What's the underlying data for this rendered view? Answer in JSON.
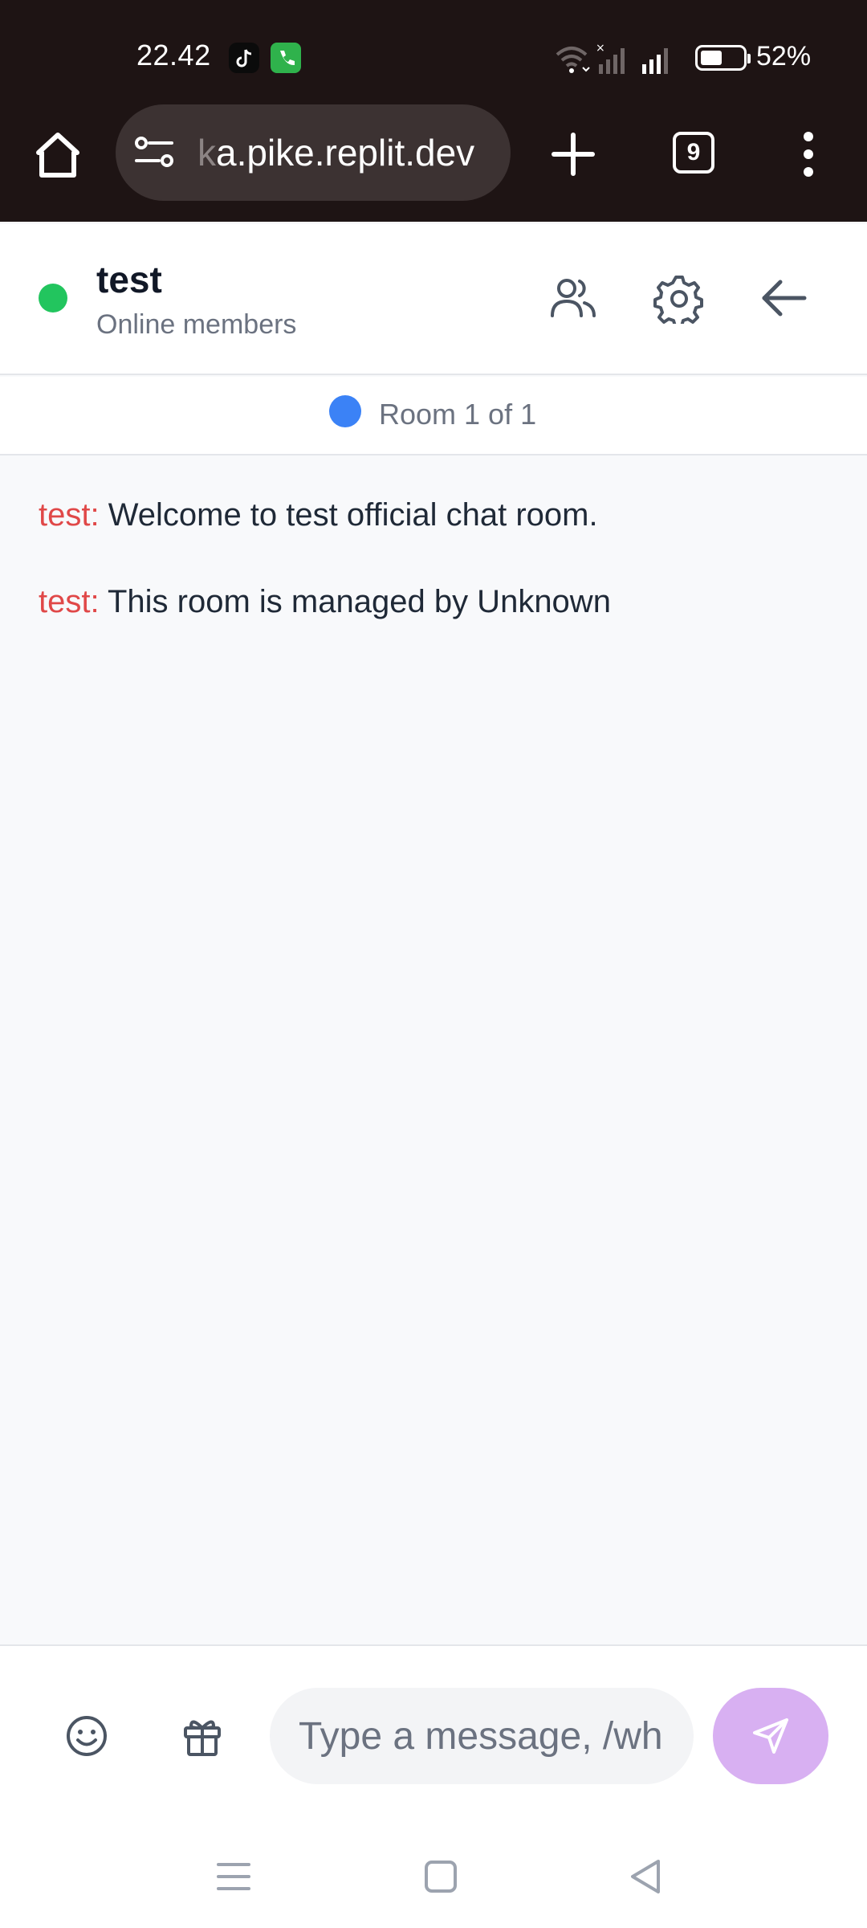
{
  "status_bar": {
    "time": "22.42",
    "battery_percent": "52%",
    "battery_level": 0.52,
    "notification_icons": [
      "tiktok-icon",
      "phone-icon"
    ],
    "system_icons": [
      "wifi-icon",
      "signal-no-service-icon",
      "signal-icon",
      "battery-icon"
    ]
  },
  "browser": {
    "url_faded": "k",
    "url": "a.pike.replit.dev",
    "tab_count": "9",
    "icons": [
      "home-icon",
      "site-settings-icon",
      "new-tab-icon",
      "tabs-icon",
      "more-menu-icon"
    ]
  },
  "header": {
    "room_name": "test",
    "subtitle": "Online members",
    "status_color": "#22c55e",
    "icons": [
      "members-icon",
      "settings-gear-icon",
      "back-arrow-icon"
    ]
  },
  "room_indicator": {
    "label": "Room 1 of 1",
    "dot_color": "#3b82f6"
  },
  "messages": [
    {
      "sender": "test:",
      "text": "Welcome to test official chat room."
    },
    {
      "sender": "test:",
      "text": "This room is managed by Unknown"
    }
  ],
  "composer": {
    "placeholder": "Type a message, /whisper",
    "value": "",
    "send_color": "#d8b0f2",
    "icons": [
      "emoji-icon",
      "gift-icon",
      "send-icon"
    ]
  },
  "nav_bar": {
    "icons": [
      "recent-apps-icon",
      "home-square-icon",
      "back-triangle-icon"
    ]
  }
}
